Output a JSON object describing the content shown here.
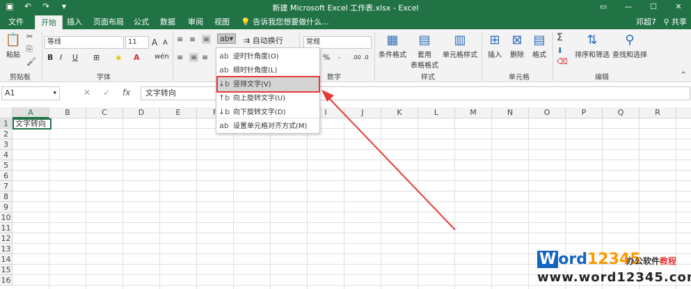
{
  "window": {
    "title": "新建 Microsoft Excel 工作表.xlsx - Excel",
    "user": "邓超7",
    "share_label": "共享"
  },
  "tabs": [
    {
      "label": "文件"
    },
    {
      "label": "开始"
    },
    {
      "label": "插入"
    },
    {
      "label": "页面布局"
    },
    {
      "label": "公式"
    },
    {
      "label": "数据"
    },
    {
      "label": "审阅"
    },
    {
      "label": "视图"
    }
  ],
  "tell_me": "告诉我您想要做什么...",
  "ribbon": {
    "clipboard": {
      "paste": "粘贴",
      "group": "剪贴板"
    },
    "font": {
      "name": "等线",
      "size": "11",
      "group": "字体",
      "bold": "B",
      "italic": "I",
      "underline": "U",
      "grow": "A",
      "shrink": "A"
    },
    "alignment": {
      "wrap": "自动换行"
    },
    "number": {
      "format": "常规",
      "percent": "%",
      "group": "数字"
    },
    "styles": {
      "cond": "条件格式",
      "table": "套用",
      "table2": "表格格式",
      "cell": "单元格样式",
      "group": "样式"
    },
    "cells": {
      "insert": "插入",
      "delete": "删除",
      "format": "格式",
      "group": "单元格"
    },
    "editing": {
      "sort": "排序和筛选",
      "find": "查找和选择",
      "sum": "Σ",
      "group": "编辑"
    }
  },
  "formula_bar": {
    "namebox": "A1",
    "fx": "fx",
    "value": "文字转向"
  },
  "columns": [
    "A",
    "B",
    "C",
    "D",
    "E",
    "F",
    "G",
    "H",
    "I",
    "J",
    "K",
    "L",
    "M",
    "N",
    "O",
    "P",
    "Q",
    "R",
    "S"
  ],
  "rows": [
    "1",
    "2",
    "3",
    "4",
    "5",
    "6",
    "7",
    "8",
    "9",
    "10",
    "11",
    "12",
    "13",
    "14",
    "15",
    "16"
  ],
  "cell_a1": "文字转向",
  "orientation_menu": [
    {
      "label": "逆时针角度(O)",
      "icon": "rotate-ccw-icon",
      "glyph": "ab"
    },
    {
      "label": "顺时针角度(L)",
      "icon": "rotate-cw-icon",
      "glyph": "ab"
    },
    {
      "label": "竖排文字(V)",
      "icon": "vertical-text-icon",
      "glyph": "↓b"
    },
    {
      "label": "向上旋转文字(U)",
      "icon": "rotate-up-icon",
      "glyph": "↑b"
    },
    {
      "label": "向下旋转文字(D)",
      "icon": "rotate-down-icon",
      "glyph": "↓b"
    },
    {
      "label": "设置单元格对齐方式(M)",
      "icon": "format-alignment-icon",
      "glyph": "ab"
    }
  ],
  "watermark": {
    "w": "W",
    "ord": "ord",
    "num": "12345",
    "tag1": "办公软件",
    "tag2": "教程",
    "url": "www.word12345.com"
  },
  "colors": {
    "excel_green": "#217346",
    "highlight_red": "#e53935"
  }
}
